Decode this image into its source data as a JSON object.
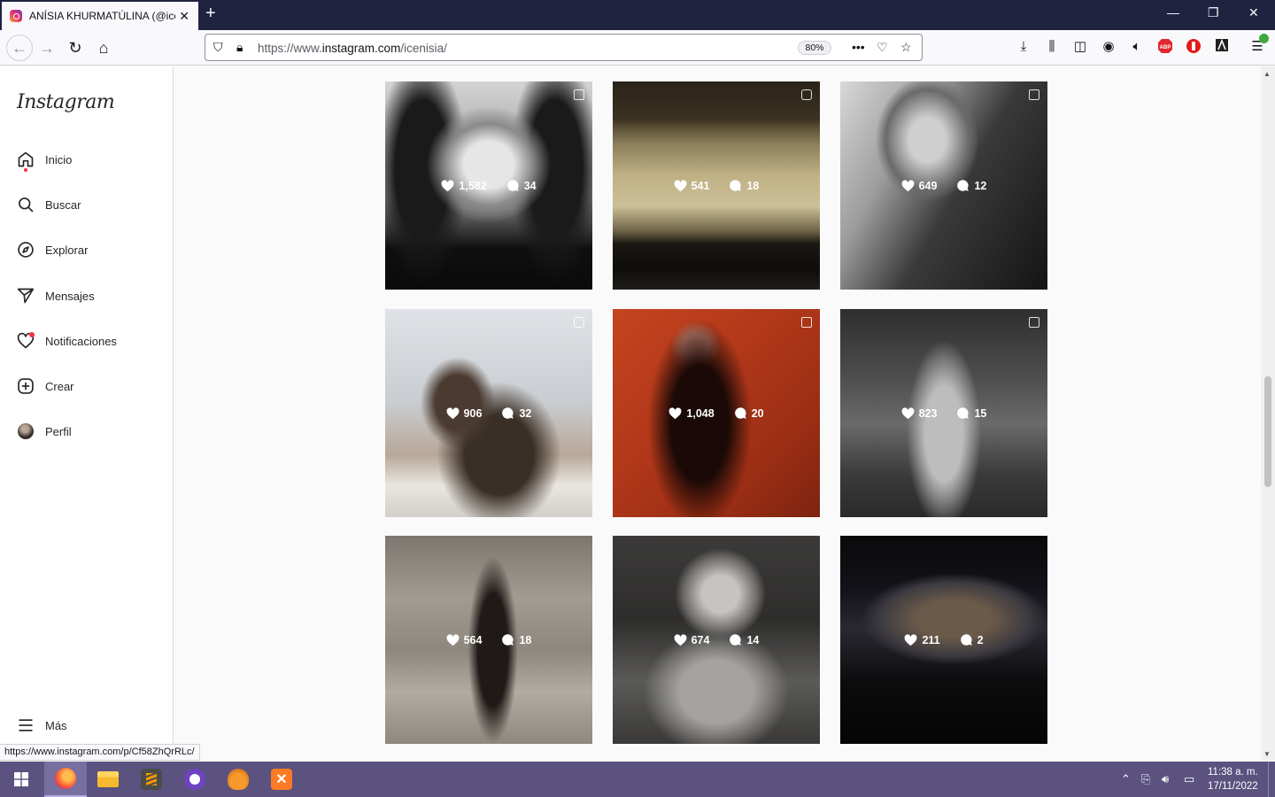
{
  "browser": {
    "tab_title": "ANÍSIA KHURMATÚLINA (@icenisia)",
    "url_prefix": "https://www.",
    "url_domain": "instagram.com",
    "url_path": "/icenisia/",
    "zoom": "80%",
    "status_url": "https://www.instagram.com/p/Cf58ZhQrRLc/"
  },
  "sidebar": {
    "logo": "Instagram",
    "items": [
      {
        "label": "Inicio",
        "icon": "home-icon"
      },
      {
        "label": "Buscar",
        "icon": "search-icon"
      },
      {
        "label": "Explorar",
        "icon": "compass-icon"
      },
      {
        "label": "Mensajes",
        "icon": "send-icon"
      },
      {
        "label": "Notificaciones",
        "icon": "heart-icon"
      },
      {
        "label": "Crear",
        "icon": "plus-square-icon"
      },
      {
        "label": "Perfil",
        "icon": "avatar"
      }
    ],
    "more_label": "Más"
  },
  "posts": [
    {
      "likes": "1,582",
      "comments": "34",
      "type": "carousel"
    },
    {
      "likes": "541",
      "comments": "18",
      "type": "reel"
    },
    {
      "likes": "649",
      "comments": "12",
      "type": "carousel"
    },
    {
      "likes": "906",
      "comments": "32",
      "type": "reel"
    },
    {
      "likes": "1,048",
      "comments": "20",
      "type": "carousel"
    },
    {
      "likes": "823",
      "comments": "15",
      "type": "carousel"
    },
    {
      "likes": "564",
      "comments": "18",
      "type": "photo"
    },
    {
      "likes": "674",
      "comments": "14",
      "type": "photo"
    },
    {
      "likes": "211",
      "comments": "2",
      "type": "photo"
    }
  ],
  "taskbar": {
    "time": "11:38 a. m.",
    "date": "17/11/2022"
  }
}
